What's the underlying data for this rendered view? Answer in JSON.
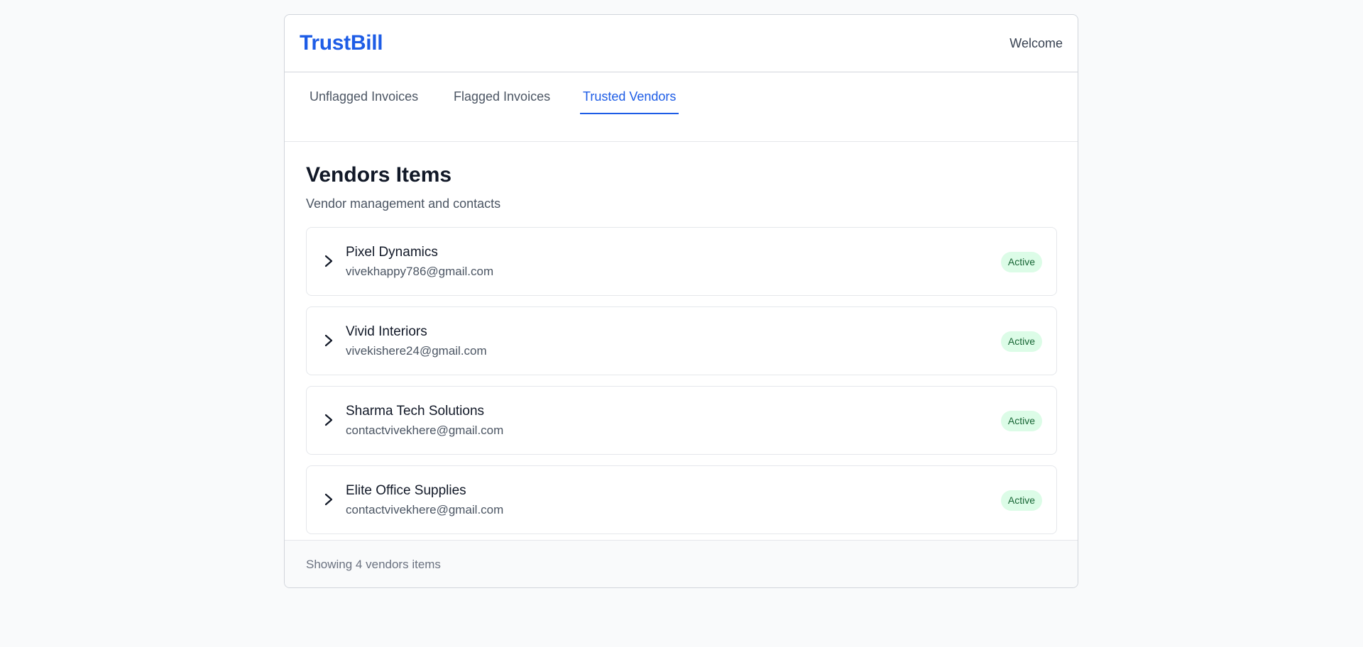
{
  "header": {
    "brand": "TrustBill",
    "welcome": "Welcome"
  },
  "tabs": [
    {
      "label": "Unflagged Invoices",
      "active": false
    },
    {
      "label": "Flagged Invoices",
      "active": false
    },
    {
      "label": "Trusted Vendors",
      "active": true
    }
  ],
  "main": {
    "title": "Vendors Items",
    "subtitle": "Vendor management and contacts"
  },
  "vendors": [
    {
      "name": "Pixel Dynamics",
      "email": "vivekhappy786@gmail.com",
      "status": "Active",
      "icon": "chevron-right-icon"
    },
    {
      "name": "Vivid Interiors",
      "email": "vivekishere24@gmail.com",
      "status": "Active",
      "icon": "chevron-right-icon"
    },
    {
      "name": "Sharma Tech Solutions",
      "email": "contactvivekhere@gmail.com",
      "status": "Active",
      "icon": "chevron-right-icon"
    },
    {
      "name": "Elite Office Supplies",
      "email": "contactvivekhere@gmail.com",
      "status": "Active",
      "icon": "chevron-right-icon"
    }
  ],
  "footer": {
    "summary": "Showing 4 vendors items"
  },
  "colors": {
    "accent": "#1d5ce6",
    "badge_bg": "#dcfce7",
    "badge_text": "#166534"
  }
}
